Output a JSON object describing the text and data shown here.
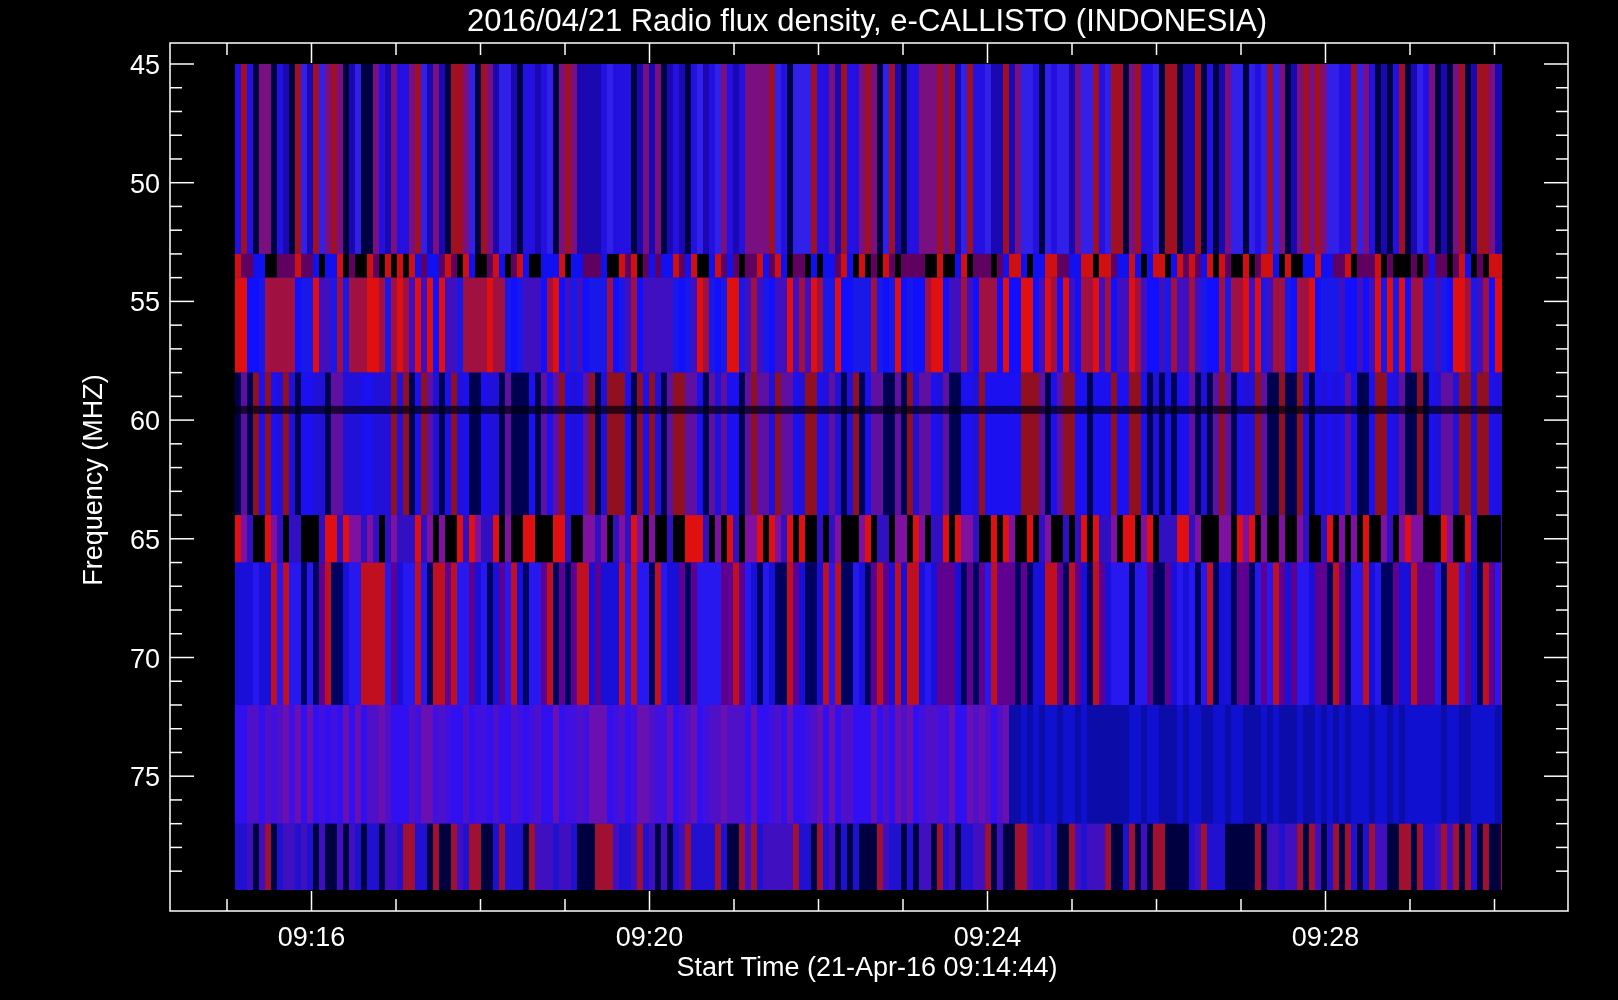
{
  "title": "2016/04/21  Radio flux density, e-CALLISTO (INDONESIA)",
  "y_axis": {
    "label": "Frequency (MHZ)",
    "ticks": [
      "45",
      "50",
      "55",
      "60",
      "65",
      "70",
      "75"
    ]
  },
  "x_axis": {
    "label": "Start Time (21-Apr-16 09:14:44)",
    "ticks": [
      "09:16",
      "09:20",
      "09:24",
      "09:28"
    ]
  }
}
